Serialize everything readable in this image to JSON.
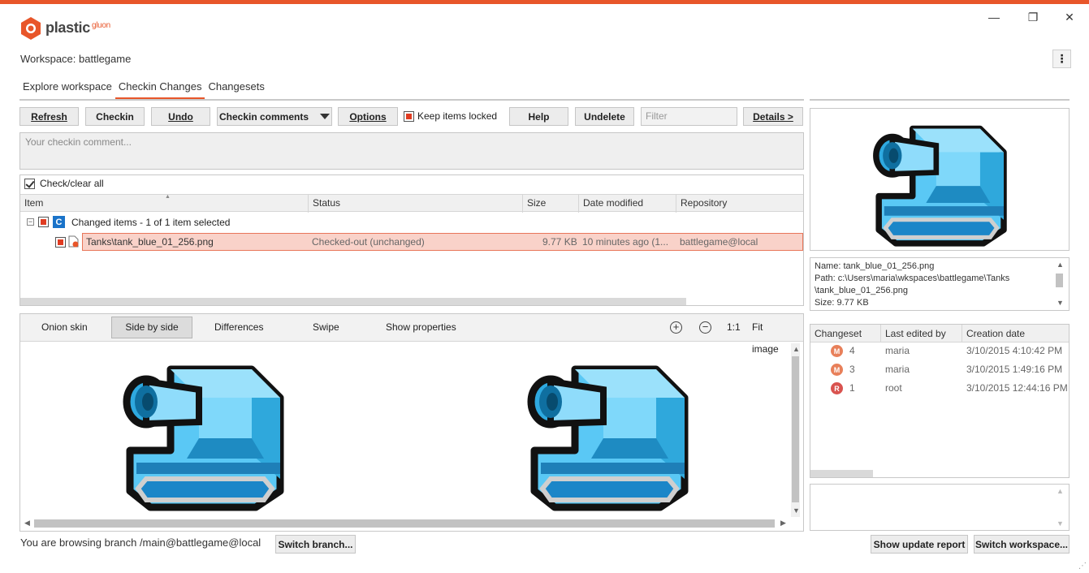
{
  "window": {
    "app_name": "plastic",
    "app_sub": "gluon",
    "minimize": "—",
    "maximize": "❐",
    "close": "✕"
  },
  "workspace_label": "Workspace: battlegame",
  "tabs": [
    {
      "label": "Explore workspace",
      "active": false
    },
    {
      "label": "Checkin Changes",
      "active": true
    },
    {
      "label": "Changesets",
      "active": false
    }
  ],
  "toolbar": {
    "refresh": "Refresh",
    "checkin": "Checkin",
    "undo": "Undo",
    "checkin_comments": "Checkin comments",
    "options": "Options",
    "keep_items_locked": "Keep items locked",
    "help": "Help",
    "undelete": "Undelete",
    "filter_placeholder": "Filter",
    "details": "Details >"
  },
  "comment_placeholder": "Your checkin comment...",
  "check_all_label": "Check/clear all",
  "columns": [
    "Item",
    "Status",
    "Size",
    "Date modified",
    "Repository"
  ],
  "group": {
    "badge": "C",
    "label": "Changed items - 1 of 1 item selected"
  },
  "file": {
    "item": "Tanks\\tank_blue_01_256.png",
    "status": "Checked-out (unchanged)",
    "size": "9.77 KB",
    "date": "10 minutes ago (1...",
    "repository": "battlegame@local"
  },
  "view_toolbar": {
    "onion": "Onion skin",
    "side": "Side by side",
    "diff": "Differences",
    "swipe": "Swipe",
    "props": "Show properties",
    "zoom_in": "+",
    "zoom_out": "−",
    "one_to_one": "1:1",
    "fit": "Fit image"
  },
  "info": {
    "name": "Name: tank_blue_01_256.png",
    "path1": "Path: c:\\Users\\maria\\wkspaces\\battlegame\\Tanks",
    "path2": "\\tank_blue_01_256.png",
    "size": "Size: 9.77 KB"
  },
  "changesets": {
    "headers": [
      "Changeset",
      "Last edited by",
      "Creation date"
    ],
    "rows": [
      {
        "badge": "M",
        "id": "4",
        "user": "maria",
        "date": "3/10/2015 4:10:42 PM",
        "color": "#e8805a"
      },
      {
        "badge": "M",
        "id": "3",
        "user": "maria",
        "date": "3/10/2015 1:49:16 PM",
        "color": "#e8805a"
      },
      {
        "badge": "R",
        "id": "1",
        "user": "root",
        "date": "3/10/2015 12:44:16 PM",
        "color": "#d9534f"
      }
    ]
  },
  "status": {
    "branch_text": "You are browsing branch /main@battlegame@local",
    "switch_branch": "Switch branch...",
    "show_update_report": "Show update report",
    "switch_workspace": "Switch workspace..."
  },
  "colors": {
    "accent": "#e8562a",
    "tank_blue": "#5ac8f5",
    "selected_row": "#f9d2c9"
  }
}
